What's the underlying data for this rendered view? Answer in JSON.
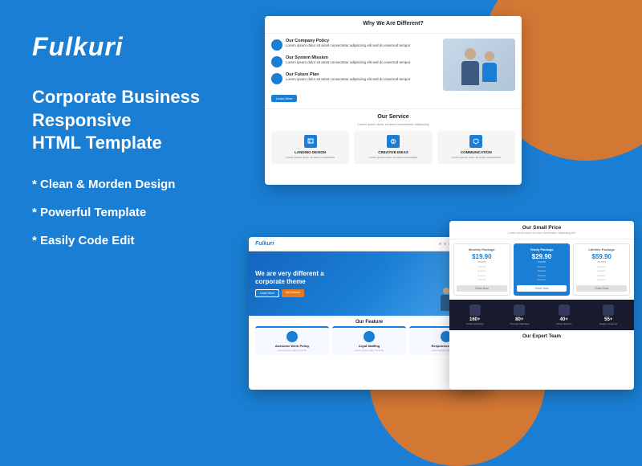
{
  "brand": {
    "logo": "Fulkuri",
    "tagline_line1": "Corporate Business Responsive",
    "tagline_line2": "HTML Template"
  },
  "features": [
    "* Clean & Morden Design",
    "* Powerful Template",
    "* Easily Code Edit"
  ],
  "screenshots": {
    "top": {
      "section1_title": "Why We Are Different?",
      "feature1_title": "Our Company Policy",
      "feature1_text": "Lorem ipsum dolor sit amet consectetur adipiscing elit sed do eiusmod tempor",
      "feature2_title": "Our System Mission",
      "feature2_text": "Lorem ipsum dolor sit amet consectetur adipiscing elit sed do eiusmod tempor",
      "feature3_title": "Our Future Plan",
      "feature3_text": "Lorem ipsum dolor sit amet consectetur adipiscing elit sed do eiusmod tempor",
      "section2_title": "Our Service",
      "section2_subtitle": "Lorem ipsum dolor sit amet consectetur adipiscing",
      "service1_title": "LANDING DESIGN",
      "service1_text": "Lorem ipsum dolor sit amet consectetur",
      "service2_title": "CREATIVE IDEAS",
      "service2_text": "Lorem ipsum dolor sit amet consectetur",
      "service3_title": "COMMUNICATION",
      "service3_text": "Lorem ipsum dolor sit amet consectetur"
    },
    "bottom_left": {
      "logo": "Fulkuri",
      "hero_title_line1": "We are very different a",
      "hero_title_line2": "corporate theme",
      "btn1": "Learn More",
      "btn2": "Get Started",
      "feature_section_title": "Our Feature",
      "card1_title": "Awesome Work Policy",
      "card1_text": "Lorem ipsum dolor sit amet",
      "card2_title": "Loyal Staffing",
      "card2_text": "Lorem ipsum dolor sit amet",
      "card3_title": "Responsive Design",
      "card3_text": "Lorem ipsum dolor sit amet"
    },
    "bottom_right": {
      "title": "Our Small Price",
      "subtitle": "Lorem ipsum dolor sit amet consectetur adipiscing elit",
      "plan1_label": "Monthly Package",
      "plan1_price": "$19.90",
      "plan1_period": "/month",
      "plan2_label": "Yearly Package",
      "plan2_price": "$29.90",
      "plan2_period": "/month",
      "plan3_label": "Lifetime Package",
      "plan3_price": "$59.90",
      "plan3_period": "/month",
      "stats": [
        {
          "num": "160+",
          "label": "Amazing Design"
        },
        {
          "num": "80+",
          "label": "Through Websites"
        },
        {
          "num": "40+",
          "label": "Active Support"
        },
        {
          "num": "55+",
          "label": "Happy Customer"
        }
      ],
      "team_title": "Our Expert Team"
    }
  },
  "colors": {
    "primary": "#1a7fd4",
    "accent": "#e87722",
    "bg": "#1a7fd4",
    "dark": "#1a1a2e",
    "white": "#ffffff"
  }
}
